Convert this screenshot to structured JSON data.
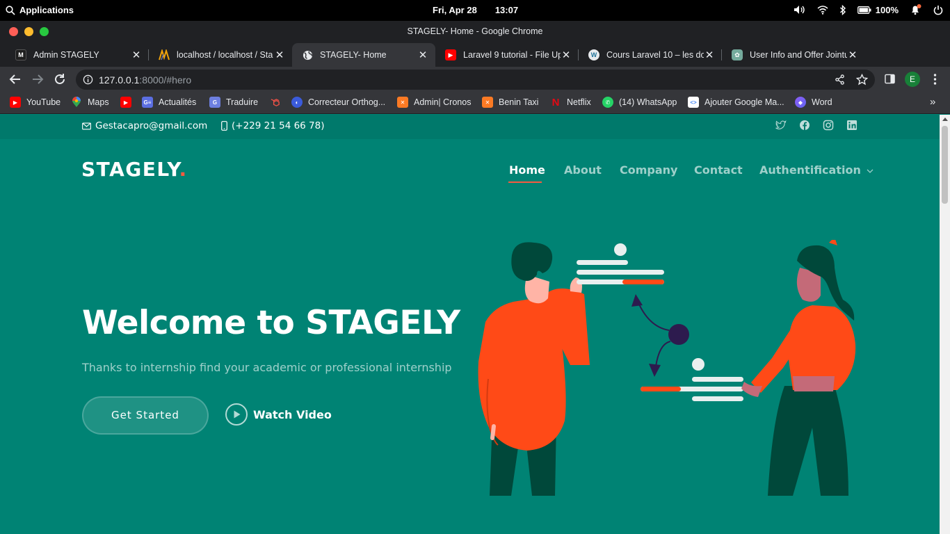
{
  "system_bar": {
    "applications_label": "Applications",
    "date": "Fri, Apr 28",
    "time": "13:07",
    "battery": "100%"
  },
  "window": {
    "title": "STAGELY- Home - Google Chrome"
  },
  "tabs": [
    {
      "label": "Admin STAGELY",
      "favicon": "admin-logo",
      "active": false
    },
    {
      "label": "localhost / localhost / Sta",
      "favicon": "phpmyadmin",
      "active": false
    },
    {
      "label": "STAGELY- Home",
      "favicon": "globe",
      "active": true
    },
    {
      "label": "Laravel 9 tutorial - File Up",
      "favicon": "youtube",
      "active": false
    },
    {
      "label": "Cours Laravel 10 – les dor",
      "favicon": "wordpress",
      "active": false
    },
    {
      "label": "User Info and Offer Jointu",
      "favicon": "chatgpt",
      "active": false
    }
  ],
  "address_bar": {
    "host": "127.0.0.1",
    "path": ":8000/#hero"
  },
  "profile_initial": "E",
  "bookmarks": [
    {
      "label": "YouTube",
      "icon": "youtube"
    },
    {
      "label": "Maps",
      "icon": "maps"
    },
    {
      "label": "",
      "icon": "youtube"
    },
    {
      "label": "Actualités",
      "icon": "news"
    },
    {
      "label": "Traduire",
      "icon": "translate"
    },
    {
      "label": "",
      "icon": "laravel"
    },
    {
      "label": "Correcteur Orthog...",
      "icon": "reverso"
    },
    {
      "label": "Admin| Cronos",
      "icon": "xampp"
    },
    {
      "label": "Benin Taxi",
      "icon": "xampp"
    },
    {
      "label": "Netflix",
      "icon": "netflix"
    },
    {
      "label": "(14) WhatsApp",
      "icon": "whatsapp"
    },
    {
      "label": "Ajouter Google Ma...",
      "icon": "code"
    },
    {
      "label": "Word",
      "icon": "word"
    }
  ],
  "topinfo": {
    "email": "Gestacapro@gmail.com",
    "phone": "(+229 21 54 66 78)",
    "socials": [
      "twitter",
      "facebook",
      "instagram",
      "linkedin"
    ]
  },
  "header": {
    "logo": "STAGELY",
    "logo_dot": ".",
    "nav": [
      {
        "label": "Home",
        "active": true
      },
      {
        "label": "About",
        "active": false
      },
      {
        "label": "Company",
        "active": false
      },
      {
        "label": "Contact",
        "active": false
      },
      {
        "label": "Authentification",
        "active": false,
        "dropdown": true
      }
    ]
  },
  "hero": {
    "title": "Welcome to STAGELY",
    "subtitle": "Thanks to internship find your academic or professional internship",
    "primary_button": "Get Started",
    "video_button": "Watch Video"
  },
  "colors": {
    "hero_bg": "#008374",
    "topbar_bg": "#00796b",
    "accent": "#f85a40",
    "illustration_orange": "#ff4a17",
    "illustration_dark": "#00483a"
  }
}
